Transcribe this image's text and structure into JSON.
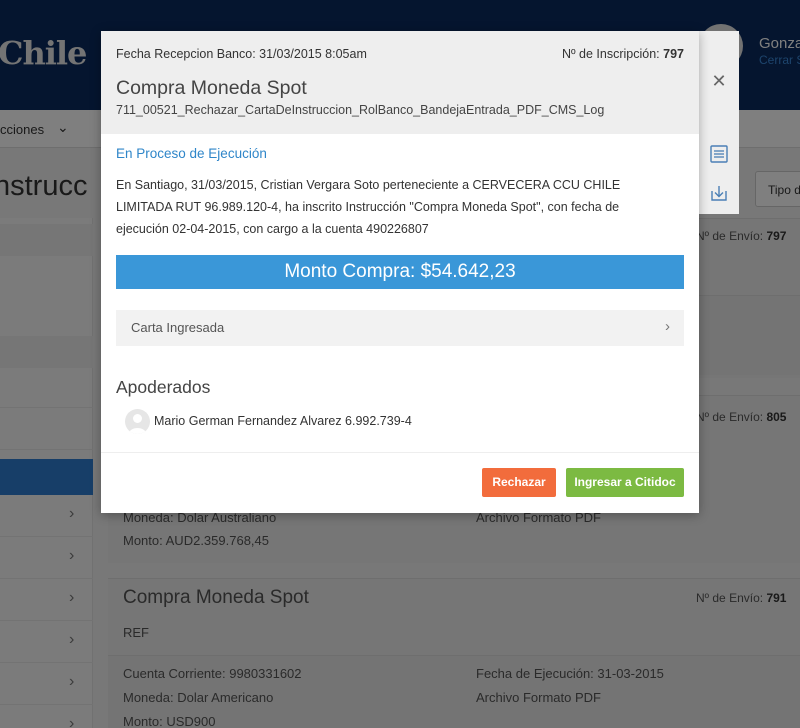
{
  "header": {
    "logo_text": "Chile",
    "user_name": "Gonza",
    "logout_text": "Cerrar S"
  },
  "nav": {
    "item_label": "cciones"
  },
  "page": {
    "title": "nstrucc",
    "type_filter_label": "Tipo d"
  },
  "cards": [
    {
      "envio_label": "Nº de Envío:",
      "envio_number": "797"
    },
    {
      "envio_label": "Nº de Envío:",
      "envio_number": "805",
      "moneda": "Moneda: Dolar Australiano",
      "monto": "Monto: AUD2.359.768,45",
      "archivo": "Archivo Formato PDF"
    },
    {
      "title": "Compra Moneda Spot",
      "envio_label": "Nº de Envío:",
      "envio_number": "791",
      "ref": "REF",
      "cuenta": "Cuenta Corriente: 9980331602",
      "fecha_ejecucion": "Fecha de Ejecución: 31-03-2015",
      "moneda": "Moneda: Dolar Americano",
      "archivo": "Archivo Formato PDF",
      "monto": "Monto: USD900"
    }
  ],
  "modal": {
    "fecha_recepcion": "Fecha Recepcion Banco: 31/03/2015 8:05am",
    "inscripcion_label": "Nº de Inscripción:",
    "inscripcion_number": "797",
    "title": "Compra Moneda Spot",
    "filename": "711_00521_Rechazar_CartaDeInstruccion_RolBanco_BandejaEntrada_PDF_CMS_Log",
    "status": "En Proceso de Ejecución",
    "description": "En Santiago, 31/03/2015, Cristian Vergara Soto perteneciente a CERVECERA CCU CHILE LIMITADA RUT 96.989.120-4, ha inscrito Instrucción \"Compra Moneda Spot\", con fecha de ejecución 02-04-2015, con cargo a la cuenta 490226807",
    "monto": "Monto Compra: $54.642,23",
    "carta_label": "Carta Ingresada",
    "apoderados_title": "Apoderados",
    "apoderado_name": "Mario German Fernandez Alvarez 6.992.739-4",
    "reject_label": "Rechazar",
    "ingresar_label": "Ingresar a Citidoc"
  },
  "colors": {
    "header_bg": "#0a2a5e",
    "status_blue": "#2f86c9",
    "monto_bar": "#3a97d8",
    "reject_orange": "#f26c3c",
    "ingresar_green": "#7cba42"
  },
  "icons": {
    "close": "close-icon",
    "list": "list-icon",
    "download": "download-icon",
    "chevron": "chevron-right-icon",
    "user": "user-icon"
  }
}
